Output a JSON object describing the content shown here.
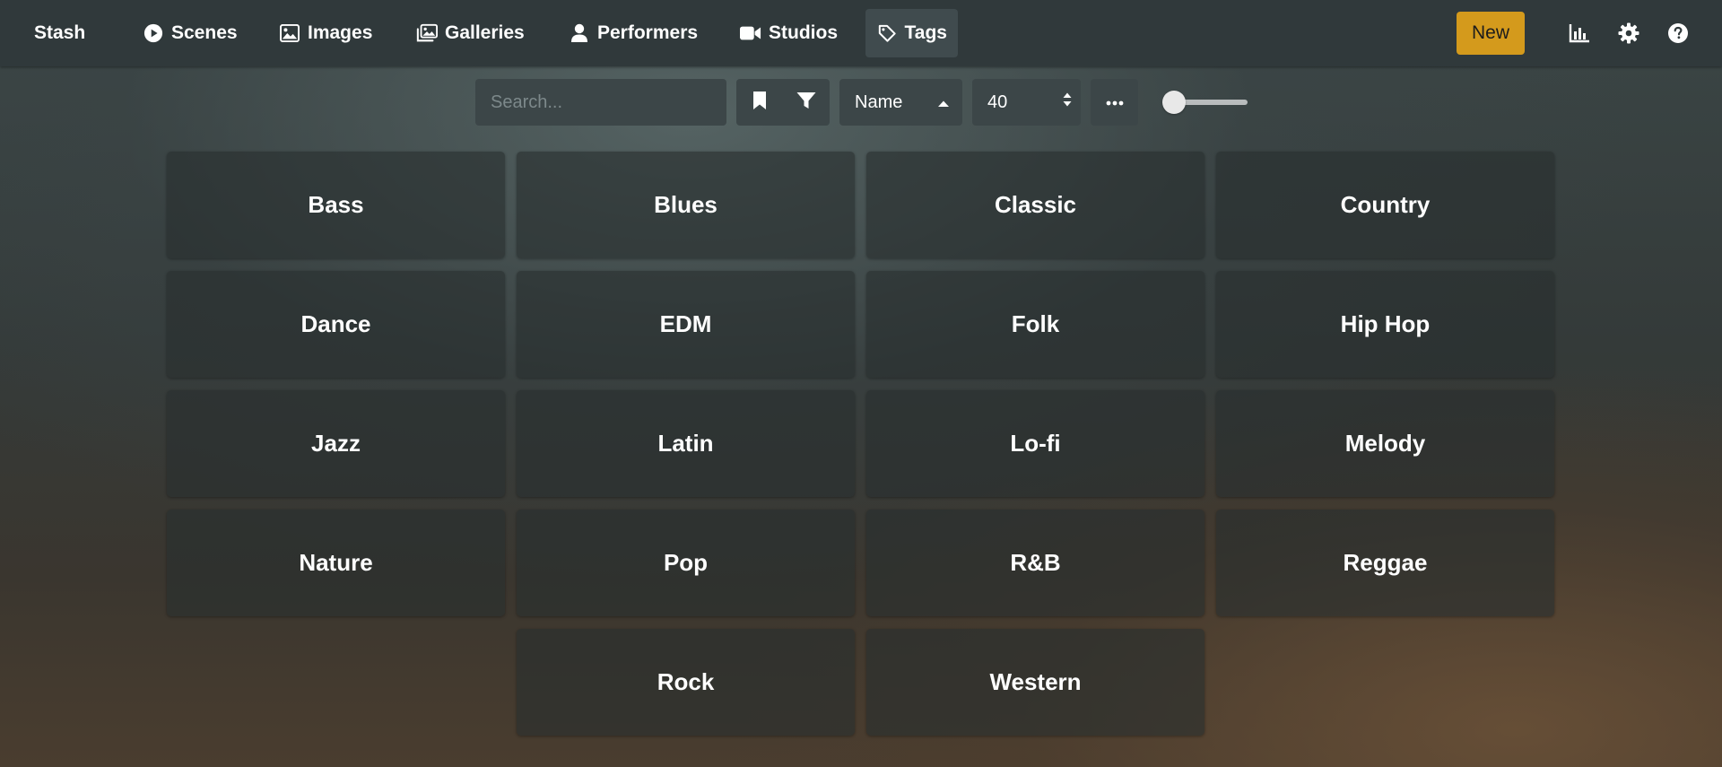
{
  "brand": "Stash",
  "nav": {
    "items": [
      {
        "label": "Scenes",
        "icon": "play-circle-icon"
      },
      {
        "label": "Images",
        "icon": "image-icon"
      },
      {
        "label": "Galleries",
        "icon": "images-icon"
      },
      {
        "label": "Performers",
        "icon": "user-icon"
      },
      {
        "label": "Studios",
        "icon": "video-icon"
      },
      {
        "label": "Tags",
        "icon": "tag-icon",
        "active": true
      }
    ],
    "new_label": "New",
    "right_icons": [
      "stats-chart-icon",
      "gear-icon",
      "help-icon"
    ]
  },
  "toolbar": {
    "search_placeholder": "Search...",
    "sort_label": "Name",
    "sort_direction": "ascending",
    "per_page": "40",
    "more_icon": "ellipsis-icon",
    "zoom_level": 0
  },
  "tags": [
    "Bass",
    "Blues",
    "Classic",
    "Country",
    "Dance",
    "EDM",
    "Folk",
    "Hip Hop",
    "Jazz",
    "Latin",
    "Lo-fi",
    "Melody",
    "Nature",
    "Pop",
    "R&B",
    "Reggae",
    "Rock",
    "Western"
  ],
  "colors": {
    "accent": "#d49a1c",
    "navbar": "#30393b",
    "control_bg": "#3c4648"
  }
}
